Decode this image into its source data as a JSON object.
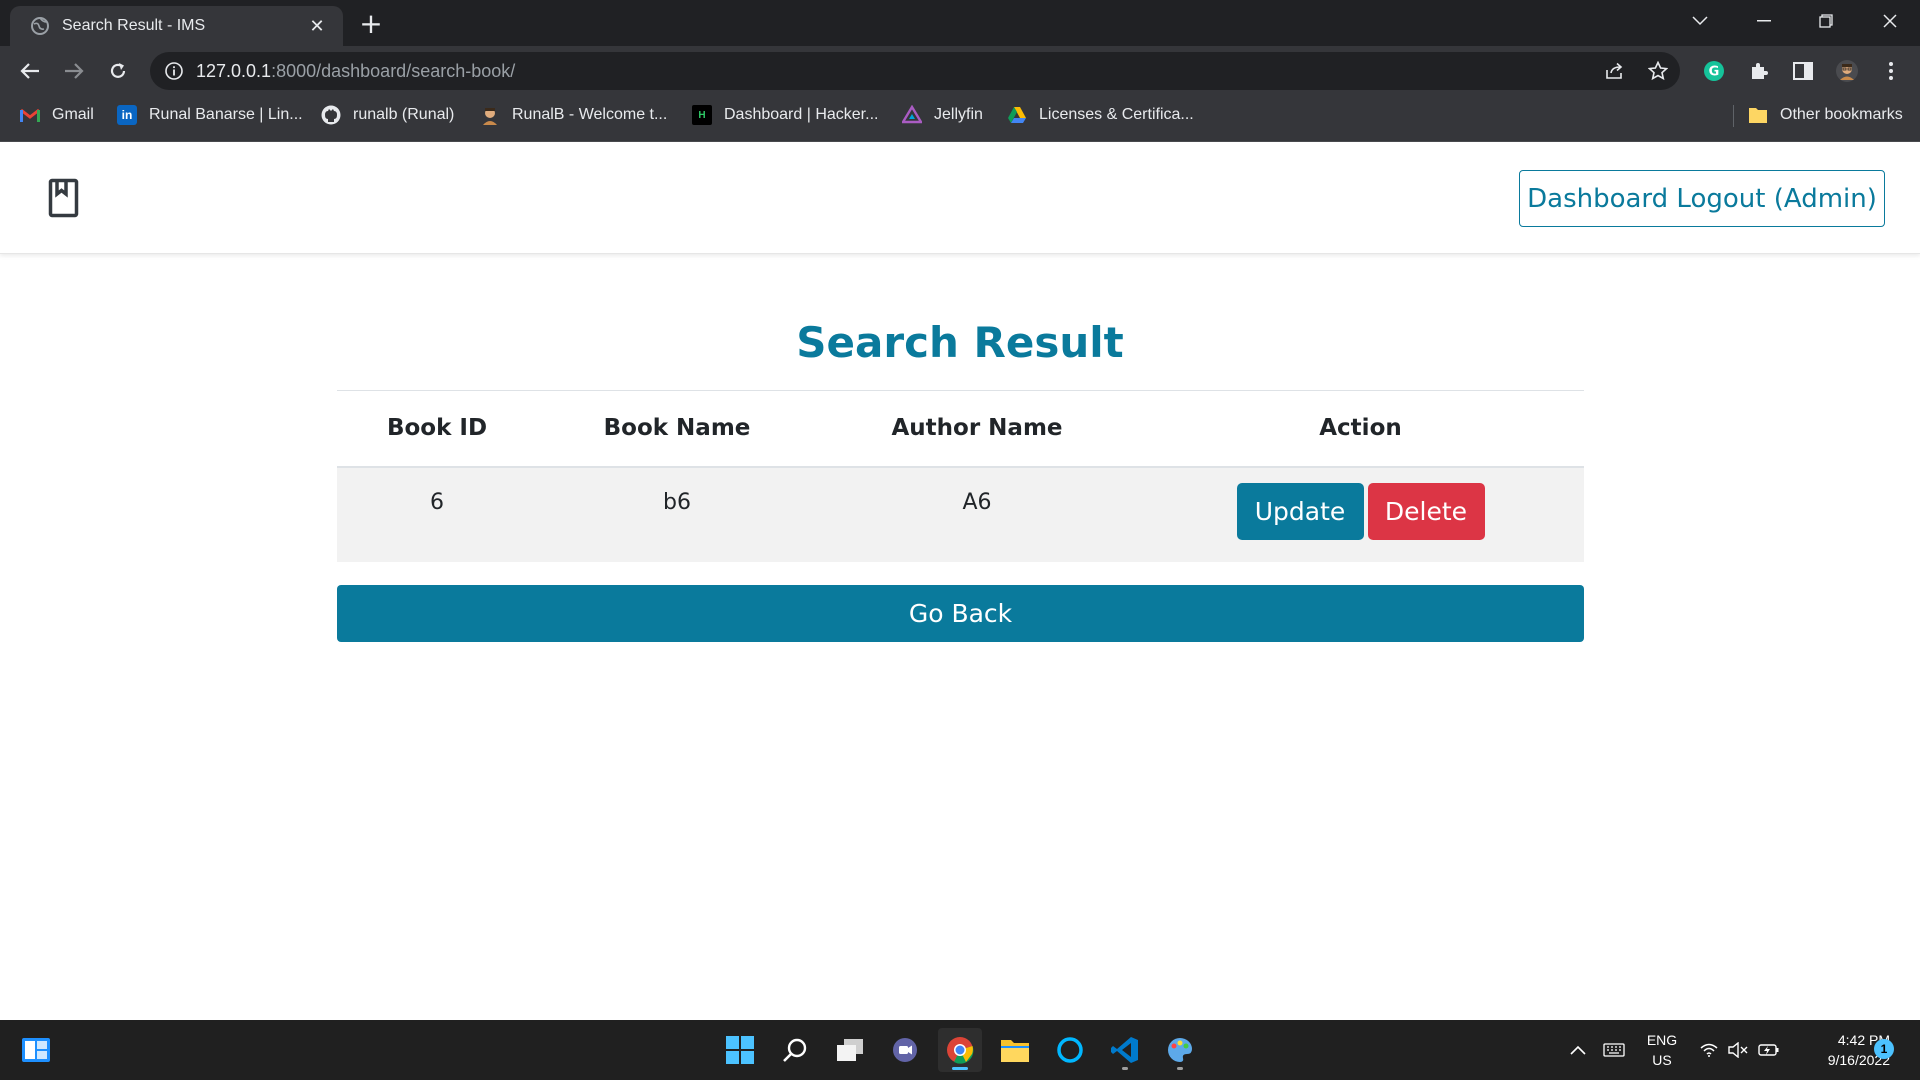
{
  "browser": {
    "tab_title": "Search Result - IMS",
    "url_host": "127.0.0.1",
    "url_rest": ":8000/dashboard/search-book/",
    "bookmarks": [
      {
        "label": "Gmail",
        "icon": "gmail-icon"
      },
      {
        "label": "Runal Banarse | Lin...",
        "icon": "linkedin-icon"
      },
      {
        "label": "runalb (Runal)",
        "icon": "github-icon"
      },
      {
        "label": "RunalB - Welcome t...",
        "icon": "avatar-icon"
      },
      {
        "label": "Dashboard | Hacker...",
        "icon": "hackerrank-icon"
      },
      {
        "label": "Jellyfin",
        "icon": "jellyfin-icon"
      },
      {
        "label": "Licenses & Certifica...",
        "icon": "google-drive-icon"
      }
    ],
    "other_bookmarks": "Other bookmarks"
  },
  "header": {
    "logout_label": "Dashboard Logout (Admin)"
  },
  "main": {
    "title": "Search Result",
    "columns": [
      "Book ID",
      "Book Name",
      "Author Name",
      "Action"
    ],
    "rows": [
      {
        "book_id": "6",
        "book_name": "b6",
        "author_name": "A6"
      }
    ],
    "update_label": "Update",
    "delete_label": "Delete",
    "go_back_label": "Go Back"
  },
  "taskbar": {
    "lang_top": "ENG",
    "lang_bottom": "US",
    "time": "4:42 PM",
    "date": "9/16/2022",
    "notification_count": "1"
  },
  "colors": {
    "brand": "#0a7a9c",
    "danger": "#dc3545"
  }
}
